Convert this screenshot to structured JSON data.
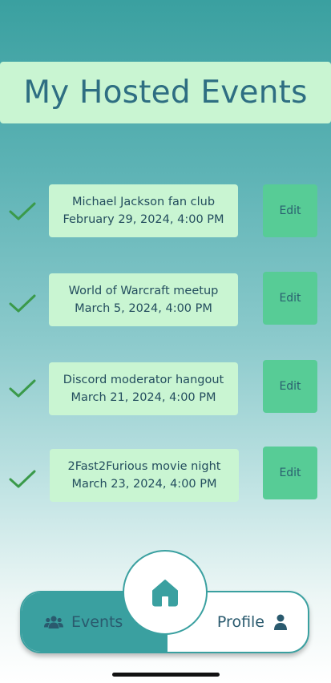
{
  "header": {
    "title": "My Hosted Events"
  },
  "events": [
    {
      "name": "Michael Jackson fan club",
      "date": "February 29, 2024, 4:00 PM",
      "edit_label": "Edit"
    },
    {
      "name": "World of Warcraft meetup",
      "date": "March 5, 2024, 4:00 PM",
      "edit_label": "Edit"
    },
    {
      "name": "Discord moderator hangout",
      "date": "March 21, 2024, 4:00 PM",
      "edit_label": "Edit"
    },
    {
      "name": "2Fast2Furious movie night",
      "date": "March 23, 2024, 4:00 PM",
      "edit_label": "Edit"
    }
  ],
  "nav": {
    "events_label": "Events",
    "profile_label": "Profile",
    "events_icon": "group-icon",
    "home_icon": "home-icon",
    "profile_icon": "person-icon"
  },
  "colors": {
    "teal": "#3aa0a0",
    "card": "#c9f5d2",
    "edit_button": "#57cc96",
    "check": "#3a9a4a",
    "text": "#2e6e82"
  }
}
